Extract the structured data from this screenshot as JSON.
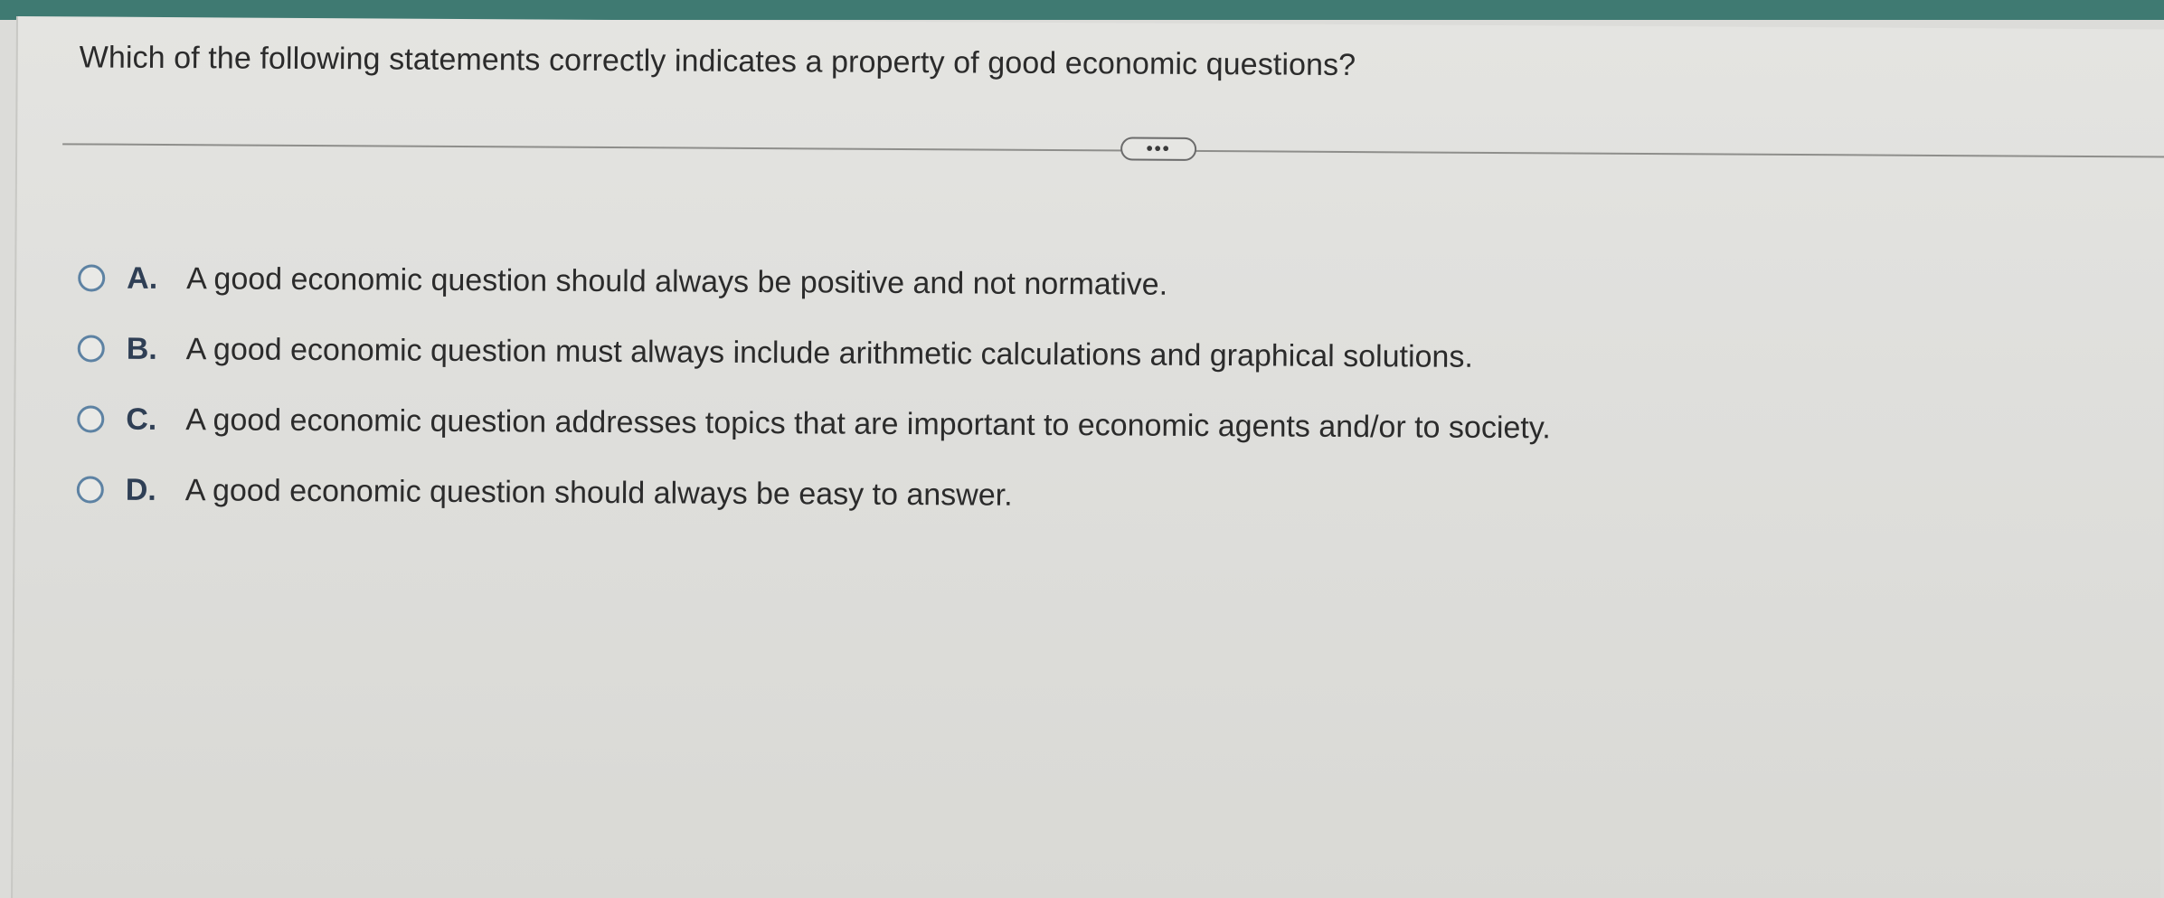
{
  "question": {
    "text": "Which of the following statements correctly indicates a property of good economic questions?"
  },
  "divider": {
    "more_label": "•••"
  },
  "options": [
    {
      "letter": "A.",
      "text": "A good economic question should always be positive and not normative.",
      "selected": false
    },
    {
      "letter": "B.",
      "text": "A good economic question must always include arithmetic calculations and graphical solutions.",
      "selected": false
    },
    {
      "letter": "C.",
      "text": "A good economic question addresses topics that are important to economic agents and/or to society.",
      "selected": false
    },
    {
      "letter": "D.",
      "text": "A good economic question should always be easy to answer.",
      "selected": false
    }
  ],
  "colors": {
    "header_band": "#3f7a72",
    "radio_border": "#5d82a3",
    "letter": "#2f3f55"
  }
}
